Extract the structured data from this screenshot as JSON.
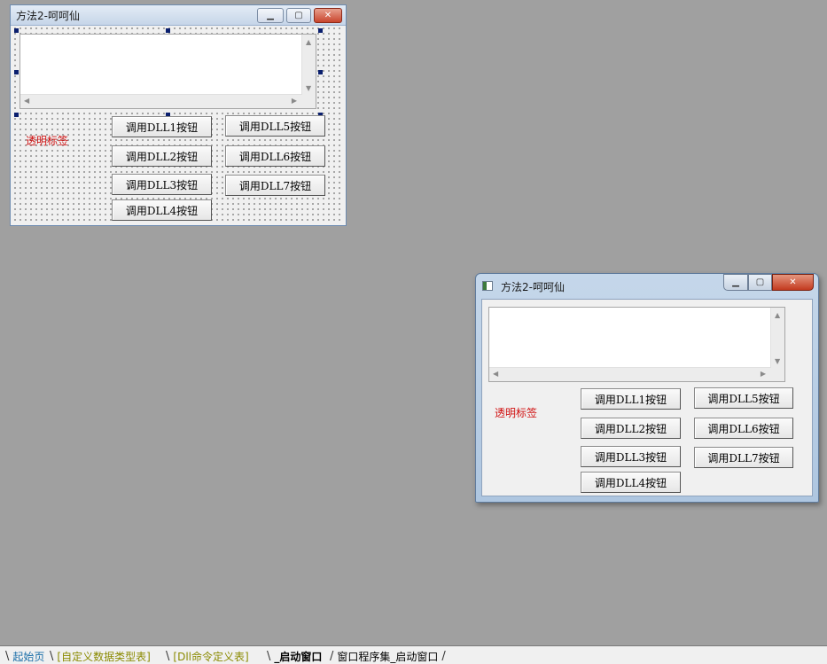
{
  "form": {
    "title": "方法2-呵呵仙",
    "label_text": "透明标签",
    "buttons": {
      "dll1": "调用DLL1按钮",
      "dll2": "调用DLL2按钮",
      "dll3": "调用DLL3按钮",
      "dll4": "调用DLL4按钮",
      "dll5": "调用DLL5按钮",
      "dll6": "调用DLL6按钮",
      "dll7": "调用DLL7按钮"
    }
  },
  "caption_icons": {
    "minimize": "minimize-icon",
    "maximize": "maximize-icon",
    "close": "close-icon"
  },
  "tabs": [
    {
      "label": "起始页",
      "color": "#1a6ea8"
    },
    {
      "label": "[自定义数据类型表]",
      "color": "#8a8a00"
    },
    {
      "label": "[Dll命令定义表]",
      "color": "#8a8a00"
    },
    {
      "label": "_启动窗口",
      "color": "#000000",
      "active": true
    },
    {
      "label": "窗口程序集_启动窗口",
      "color": "#000000"
    }
  ],
  "colors": {
    "label_red": "#d01010",
    "desktop_gray": "#a0a0a0"
  }
}
